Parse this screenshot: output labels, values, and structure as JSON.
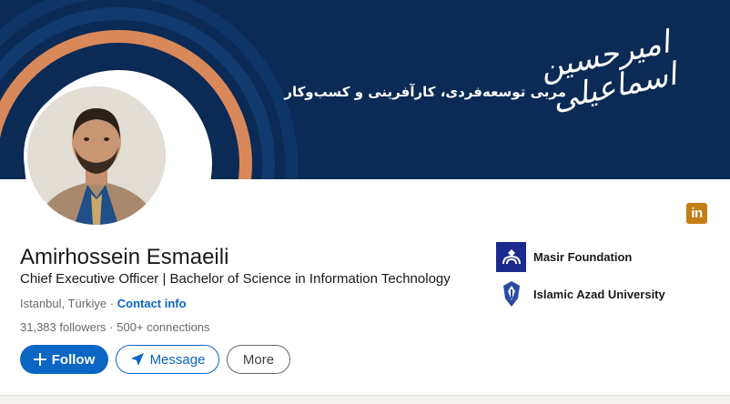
{
  "banner": {
    "tagline": "مربی توسعه‌فردی، کارآفرینی و کسب‌وکار",
    "calligraphy": "امیرحسین اسماعیلی",
    "colors": {
      "navy": "#0b2a55",
      "ring_dark": "#0f3568",
      "ring_orange": "#d9885a"
    }
  },
  "profile": {
    "name": "Amirhossein Esmaeili",
    "headline": "Chief Executive Officer | Bachelor of Science in Information Technology",
    "location": "Istanbul, Türkiye",
    "separator": "·",
    "contact_info": "Contact info",
    "followers": "31,383 followers",
    "connections": "500+ connections"
  },
  "actions": {
    "follow": "Follow",
    "message": "Message",
    "more": "More"
  },
  "linkedin_badge": {
    "label": "in",
    "icon": "linkedin-icon",
    "color": "#c37d16"
  },
  "organizations": [
    {
      "name": "Masir Foundation",
      "icon": "masir-foundation-logo"
    },
    {
      "name": "Islamic Azad University",
      "icon": "islamic-azad-university-logo"
    }
  ],
  "colors": {
    "accent": "#0a66c2"
  }
}
